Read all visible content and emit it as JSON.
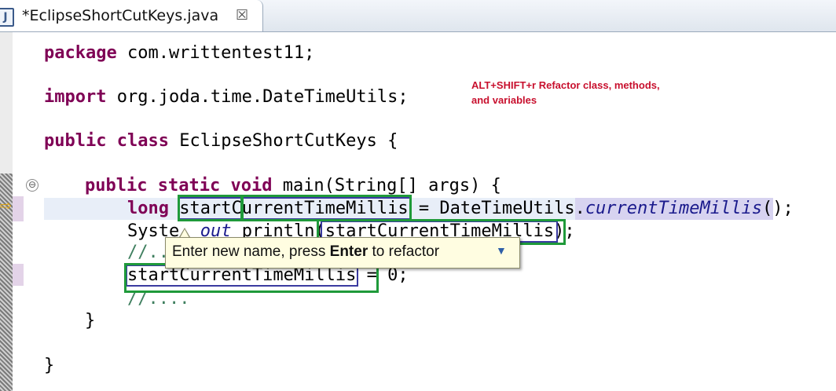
{
  "editor_tab": {
    "icon": "java-file-icon",
    "icon_glyph": "J",
    "title": "*EclipseShortCutKeys.java",
    "close_glyph": "☒"
  },
  "annotation": {
    "line1": "ALT+SHIFT+r Refactor class, methods,",
    "line2": "and variables",
    "color": "#c8102e"
  },
  "code": {
    "l1": {
      "kw": "package",
      "rest": " com.writtentest11;"
    },
    "l2": {
      "kw": "import",
      "rest": " org.joda.time.DateTimeUtils;"
    },
    "l3": {
      "kw1": "public",
      "kw2": "class",
      "rest": " EclipseShortCutKeys {"
    },
    "l4": {
      "kw1": "public",
      "kw2": "static",
      "kw3": "void",
      "rest": " main(String[] args) {"
    },
    "l5": {
      "kw": "long",
      "var": "startCurrentTimeMillis",
      "mid": " = DateTimeUtils.",
      "call": "currentTimeMillis",
      "end": "();"
    },
    "l6": {
      "pre": "Syste",
      "gap": "  ",
      "out": "out",
      "mid": " println(",
      "var": "startCurrentTimeMillis",
      "end": ");"
    },
    "l7": {
      "text": "//.."
    },
    "l8": {
      "var": "startCurrentTimeMillis",
      "rest": " = 0;"
    },
    "l9": {
      "text": "//...."
    },
    "l10": {
      "text": "}"
    },
    "l11": {
      "text": "}"
    }
  },
  "fold_glyph": "⊖",
  "current_line_marker": "⇨",
  "rename_tooltip": {
    "prefix": "Enter new name, press ",
    "bold": "Enter",
    "suffix": " to refactor",
    "menu_glyph": "▼"
  },
  "colors": {
    "keyword": "#7f0055",
    "highlight_box": "#1f9a3a",
    "tooltip_bg": "#fffde1"
  }
}
